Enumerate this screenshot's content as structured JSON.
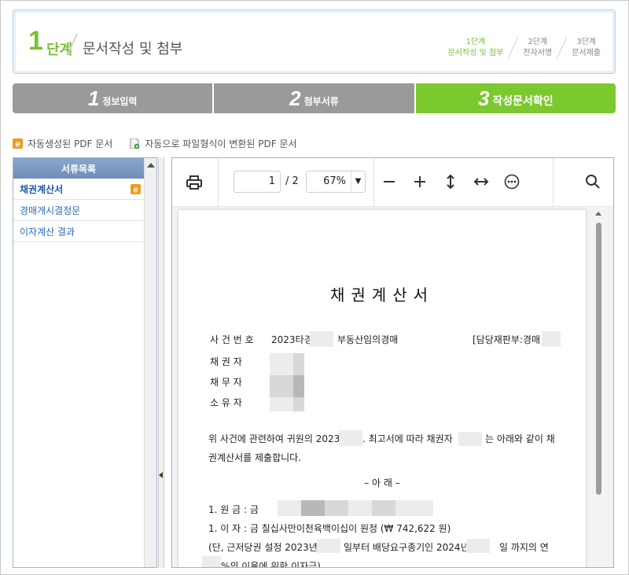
{
  "header": {
    "step_number": "1",
    "step_word": "단계",
    "step_title": "문서작성 및 첨부",
    "mini_steps": [
      {
        "top": "1단계",
        "bottom": "문서작성 및 첨부"
      },
      {
        "top": "2단계",
        "bottom": "전자서명"
      },
      {
        "top": "3단계",
        "bottom": "문서제출"
      }
    ]
  },
  "tabs": [
    {
      "num": "1",
      "label": "정보입력"
    },
    {
      "num": "2",
      "label": "첨부서류"
    },
    {
      "num": "3",
      "label": "작성문서확인"
    }
  ],
  "legend": {
    "auto_pdf": "자동생성된 PDF 문서",
    "converted_pdf": "자동으로 파일형식이 변환된 PDF 문서"
  },
  "sidebar": {
    "title": "서류목록",
    "items": [
      {
        "label": "채권계산서"
      },
      {
        "label": "경매개시결정문"
      },
      {
        "label": "이자계산 결과"
      }
    ]
  },
  "viewer": {
    "page_current": "1",
    "page_total": "/ 2",
    "zoom": "67%",
    "icons": [
      "print-icon",
      "zoom-out-icon",
      "zoom-in-icon",
      "fit-height-icon",
      "fit-width-icon",
      "more-icon",
      "search-icon"
    ]
  },
  "document": {
    "title": "채권계산서",
    "case_label": "사 건 번 호",
    "case_value_prefix": "2023타경",
    "case_value_suffix": "부동산임의경매",
    "judge": "[담당재판부:경매",
    "creditor": "채 권 자",
    "debtor": "채 무 자",
    "owner": "소 유 자",
    "para1a": "위 사건에 관련하여 귀원의 2023",
    "para1b": ". 최고서에 따라 채권자",
    "para1c": "는 아래와 같이 채",
    "para1d": "권계산서를 제출합니다.",
    "below": "– 아    래 –",
    "principal": "1.  원    금 : 금",
    "interest": "1.  이    자 : 금  칠십사만이천육백이십이  원정  (₩  742,622  원)",
    "note_a": "(단, 근저당권 설정 2023년",
    "note_b": "일부터 배당요구종기인 2024년",
    "note_c": "일 까지의 연",
    "note_d": "%의 이율에 위한 이자금)"
  }
}
